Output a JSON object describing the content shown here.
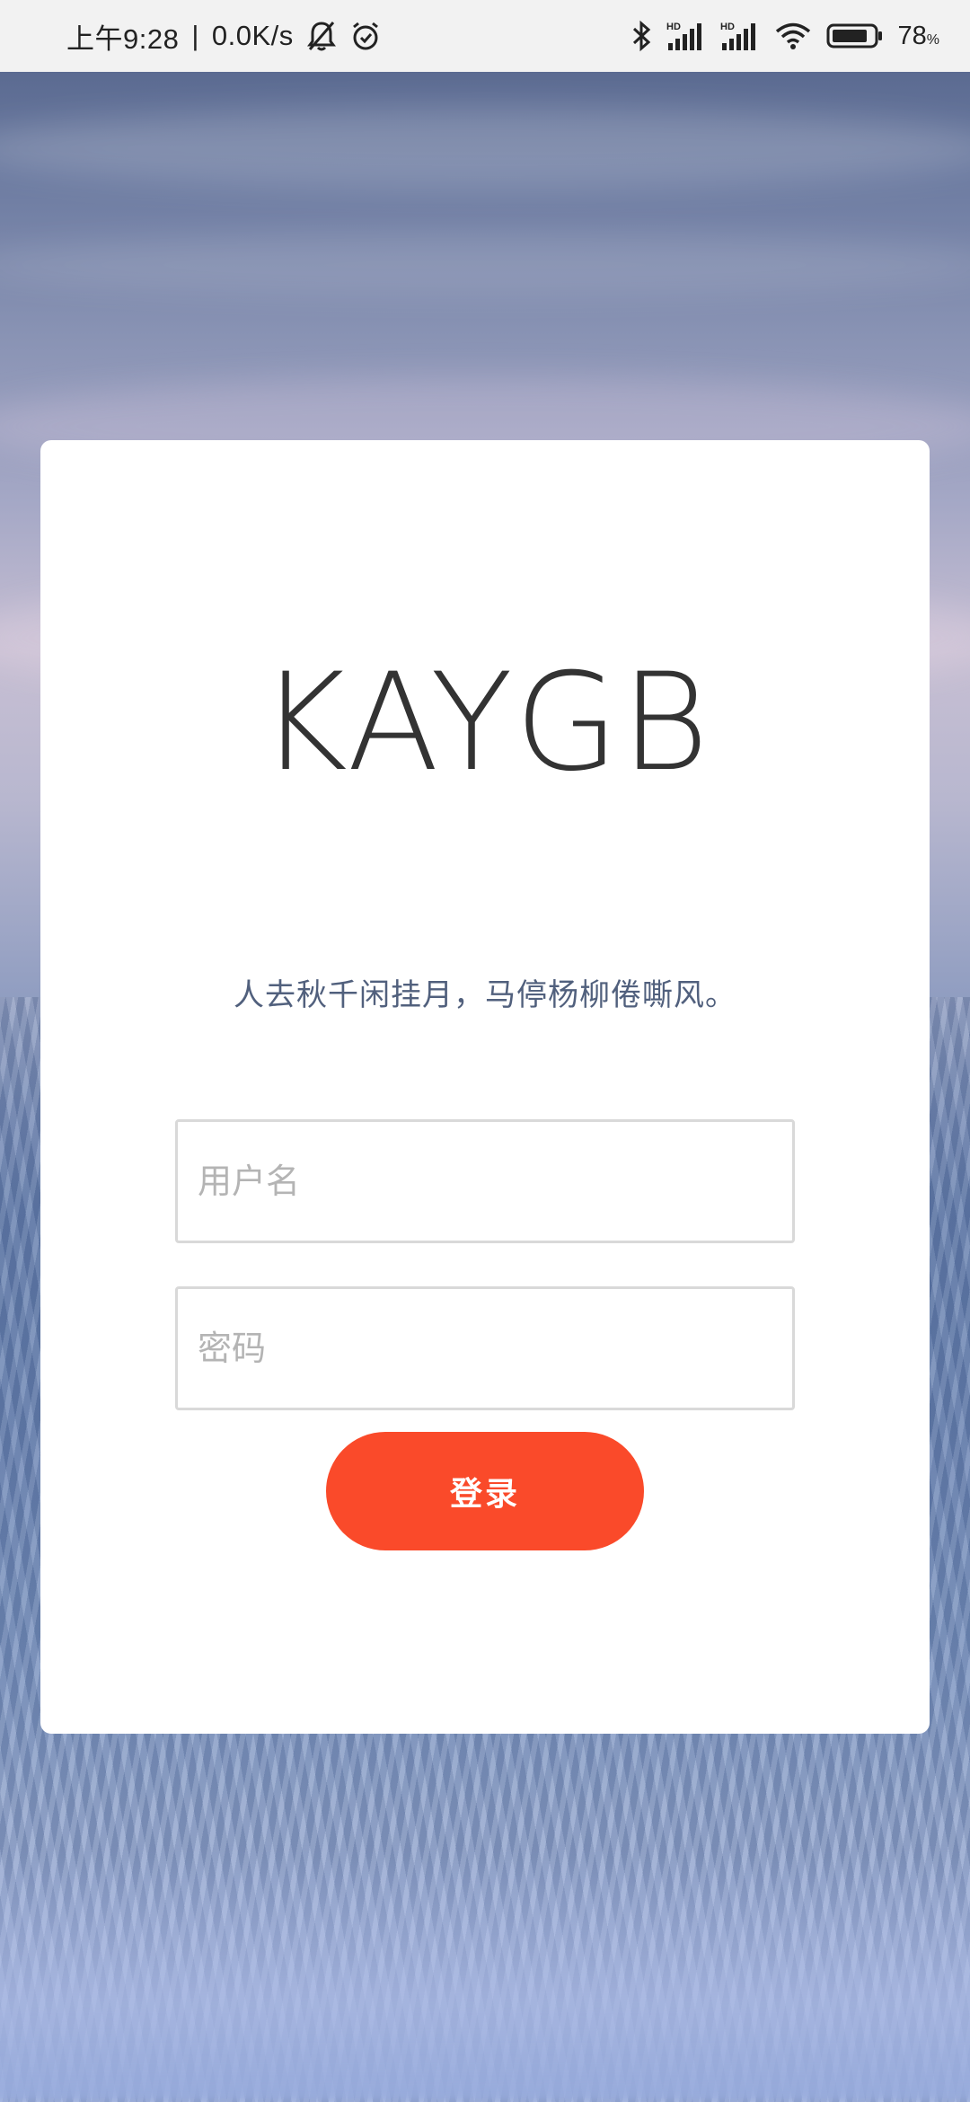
{
  "status_bar": {
    "time": "上午9:28",
    "separator": "|",
    "network_speed": "0.0K/s",
    "icons": [
      "bell-muted-icon",
      "alarm-icon",
      "bluetooth-icon",
      "hd-signal-icon",
      "hd-signal-icon",
      "wifi-icon",
      "battery-icon"
    ],
    "battery_percent": "78",
    "battery_unit": "%"
  },
  "login": {
    "title": "KAYGB",
    "subtitle": "人去秋千闲挂月，马停杨柳倦嘶风。",
    "username_placeholder": "用户名",
    "password_placeholder": "密码",
    "submit_label": "登录"
  },
  "colors": {
    "accent": "#fa4a2a",
    "title": "#333333",
    "subtitle": "#51607d",
    "input_border": "#d9d9d9",
    "placeholder": "#b4b4b4"
  }
}
